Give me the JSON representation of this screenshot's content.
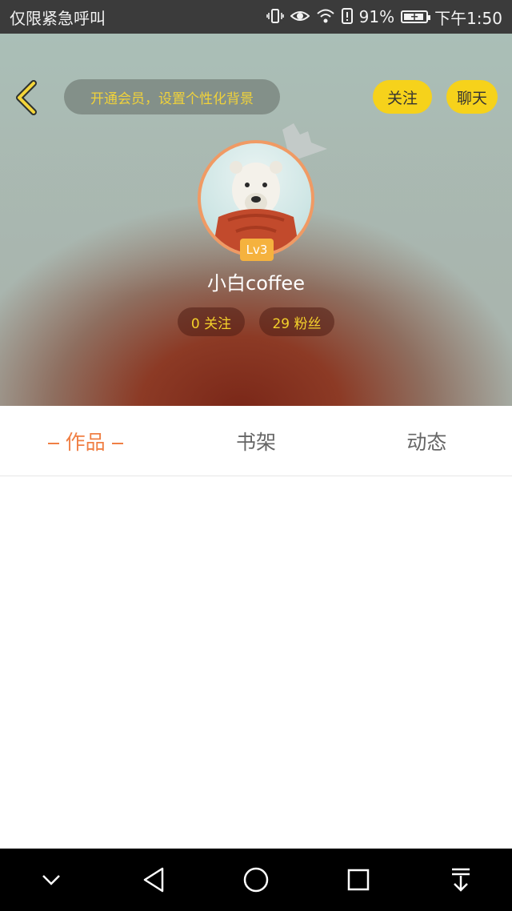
{
  "status_bar": {
    "carrier": "仅限紧急呼叫",
    "battery_percent": "91%",
    "time": "下午1:50",
    "battery_level": 0.91
  },
  "header": {
    "vip_text": "开通会员，设置个性化背景",
    "follow_label": "关注",
    "chat_label": "聊天"
  },
  "profile": {
    "level": "Lv3",
    "nickname": "小白coffee",
    "following": "0 关注",
    "fans": "29 粉丝"
  },
  "tabs": [
    {
      "label": "作品",
      "active": true
    },
    {
      "label": "书架",
      "active": false
    },
    {
      "label": "动态",
      "active": false
    }
  ],
  "colors": {
    "accent": "#f07f44",
    "button_yellow": "#f6d21b",
    "stat_text": "#f4d12b"
  },
  "icons": {
    "back": "chevron-left-icon",
    "crown": "crown-icon",
    "nav": [
      "chevron-down-icon",
      "back-triangle-icon",
      "home-circle-icon",
      "recents-square-icon",
      "download-icon"
    ]
  }
}
